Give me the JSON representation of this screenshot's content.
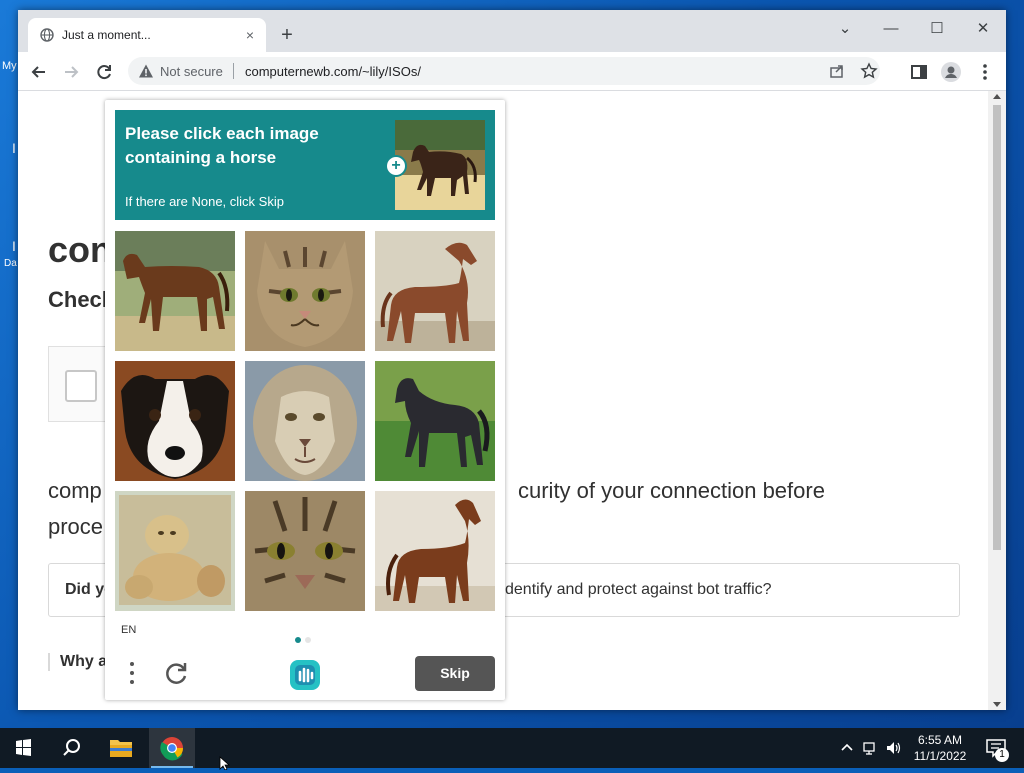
{
  "desktop": {
    "icon_label_1": "My",
    "icon_label_2": "Da",
    "icon_label_3": "I"
  },
  "browser": {
    "tab_title": "Just a moment...",
    "tab_close": "×",
    "new_tab": "+",
    "controls": {
      "dropdown": "⌄",
      "minimize": "—",
      "maximize": "☐",
      "close": "✕"
    },
    "security_label": "Not secure",
    "url": "computernewb.com/~lily/ISOs/"
  },
  "page": {
    "heading": "con",
    "subheading": "Checl",
    "paragraph_left_1": "comp",
    "paragraph_right_1": "curity of your connection before",
    "paragraph_left_2": "proce",
    "faq_left": "Did yo",
    "faq_right": "dentify and protect against bot traffic?",
    "why_text": "Why a"
  },
  "captcha": {
    "prompt": "Please click each image containing a horse",
    "hint": "If there are None, click Skip",
    "language": "EN",
    "skip_label": "Skip",
    "accent_color": "#168a8c",
    "tiles": [
      {
        "subject": "brown-horse"
      },
      {
        "subject": "tabby-cat"
      },
      {
        "subject": "chestnut-horse"
      },
      {
        "subject": "border-collie-dog"
      },
      {
        "subject": "lion"
      },
      {
        "subject": "black-horse"
      },
      {
        "subject": "lion-cubs"
      },
      {
        "subject": "tabby-cat-closeup"
      },
      {
        "subject": "brown-horse-standing"
      }
    ],
    "page_dots": 2
  },
  "taskbar": {
    "time": "6:55 AM",
    "date": "11/1/2022",
    "notification_count": "1"
  }
}
